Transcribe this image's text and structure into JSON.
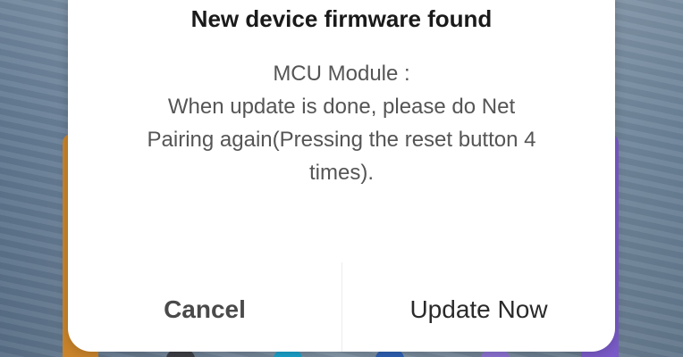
{
  "dialog": {
    "title": "New device firmware found",
    "message_lines": [
      "MCU Module :",
      "When update is done, please do Net",
      "Pairing again(Pressing the reset button 4",
      "times)."
    ],
    "buttons": {
      "cancel_label": "Cancel",
      "update_label": "Update Now"
    }
  },
  "colors": {
    "dialog_bg": "#ffffff",
    "title": "#1a1a1a",
    "message": "#555555",
    "cancel": "#4a4a4a",
    "update": "#2a2a2a"
  }
}
